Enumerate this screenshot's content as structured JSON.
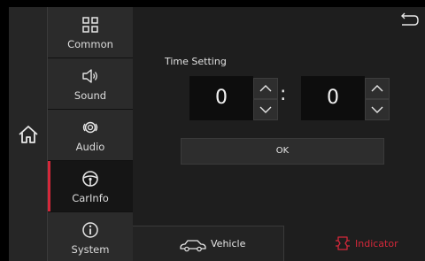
{
  "menu": {
    "items": [
      {
        "label": "Common",
        "icon": "grid-icon"
      },
      {
        "label": "Sound",
        "icon": "speaker-icon"
      },
      {
        "label": "Audio",
        "icon": "audio-icon"
      },
      {
        "label": "CarInfo",
        "icon": "steering-wheel-icon",
        "active": true
      },
      {
        "label": "System",
        "icon": "info-icon"
      }
    ]
  },
  "time_setting": {
    "label": "Time Setting",
    "hours": "0",
    "separator": ":",
    "minutes": "0",
    "ok_label": "OK"
  },
  "tabs": {
    "vehicle_label": "Vehicle",
    "indicator_label": "Indicator"
  },
  "colors": {
    "accent": "#d4283a",
    "background": "#1f1f1f"
  }
}
